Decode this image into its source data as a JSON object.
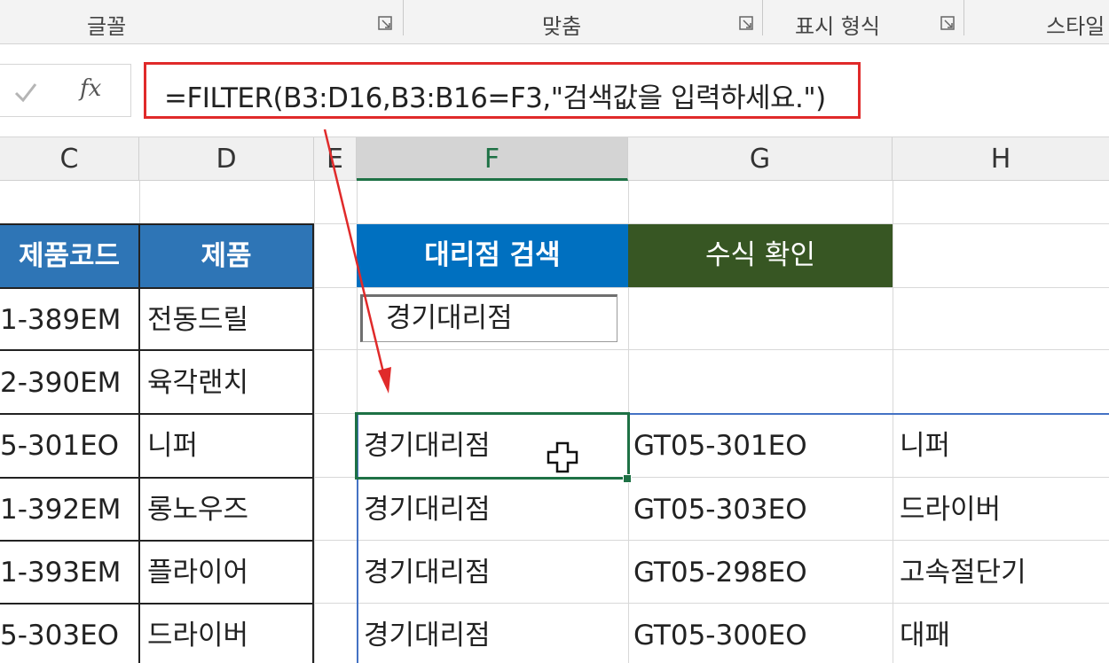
{
  "ribbon": {
    "groups": [
      {
        "label": "글꼴"
      },
      {
        "label": "맞춤"
      },
      {
        "label": "표시 형식"
      },
      {
        "label": "스타일"
      }
    ]
  },
  "formula_bar": {
    "formula": "=FILTER(B3:D16,B3:B16=F3,\"검색값을 입력하세요.\")",
    "fx_label": "fx"
  },
  "columns": [
    "C",
    "D",
    "E",
    "F",
    "G",
    "H"
  ],
  "left_table": {
    "headers": [
      "제품코드",
      "제품"
    ],
    "rows": [
      {
        "code": "1-389EM",
        "product": "전동드릴"
      },
      {
        "code": "2-390EM",
        "product": "육각랜치"
      },
      {
        "code": "5-301EO",
        "product": "니퍼"
      },
      {
        "code": "1-392EM",
        "product": "롱노우즈"
      },
      {
        "code": "1-393EM",
        "product": "플라이어"
      },
      {
        "code": "5-303EO",
        "product": "드라이버"
      }
    ]
  },
  "search": {
    "header": "대리점 검색",
    "value": "경기대리점"
  },
  "formula_check": {
    "header": "수식 확인"
  },
  "results": [
    {
      "dealer": "경기대리점",
      "code": "GT05-301EO",
      "product": "니퍼"
    },
    {
      "dealer": "경기대리점",
      "code": "GT05-303EO",
      "product": "드라이버"
    },
    {
      "dealer": "경기대리점",
      "code": "GT05-298EO",
      "product": "고속절단기"
    },
    {
      "dealer": "경기대리점",
      "code": "GT05-300EO",
      "product": "대패"
    }
  ],
  "colors": {
    "search_header_bg": "#0070c0",
    "check_header_bg": "#375623",
    "left_header_bg": "#2e75b6",
    "formula_outline": "#e02a2a",
    "active_cell": "#1e7145"
  }
}
